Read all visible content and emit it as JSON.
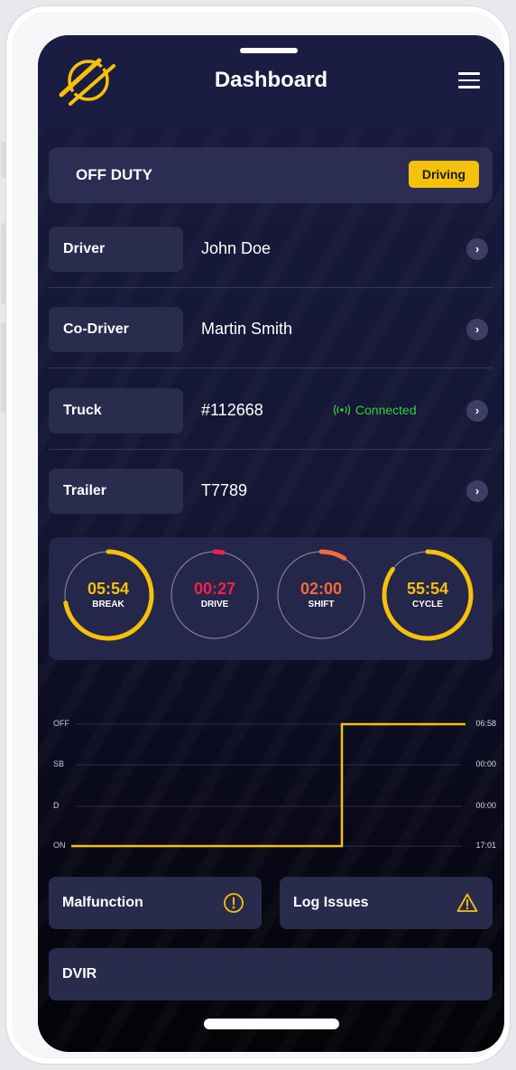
{
  "header": {
    "title": "Dashboard",
    "logo_icon": "logo-icon",
    "menu_icon": "hamburger-icon"
  },
  "status": {
    "label": "OFF DUTY",
    "badge": "Driving",
    "badge_color": "#f5c10b"
  },
  "rows": [
    {
      "label": "Driver",
      "value": "John Doe"
    },
    {
      "label": "Co-Driver",
      "value": "Martin Smith"
    },
    {
      "label": "Truck",
      "value": "#112668",
      "connection": "Connected"
    },
    {
      "label": "Trailer",
      "value": "T7789"
    }
  ],
  "timers": [
    {
      "label": "BREAK",
      "value": "05:54",
      "color": "#f5c10b",
      "progress": 0.72
    },
    {
      "label": "DRIVE",
      "value": "00:27",
      "color": "#f0224b",
      "progress": 0.03
    },
    {
      "label": "SHIFT",
      "value": "02:00",
      "color": "#f26b3a",
      "progress": 0.09
    },
    {
      "label": "CYCLE",
      "value": "55:54",
      "color": "#f5c10b",
      "progress": 0.85
    }
  ],
  "log_chart": {
    "statuses": [
      "OFF",
      "SB",
      "D",
      "ON"
    ],
    "totals": [
      "06:58",
      "00:00",
      "00:00",
      "17:01"
    ],
    "line_color": "#f5c10b"
  },
  "cards": {
    "malfunction": {
      "label": "Malfunction",
      "icon": "info-circle-icon"
    },
    "log_issues": {
      "label": "Log Issues",
      "icon": "warning-triangle-icon"
    },
    "dvir": {
      "label": "DVIR"
    }
  },
  "colors": {
    "accent": "#f5c10b",
    "connected": "#31cf3d"
  }
}
